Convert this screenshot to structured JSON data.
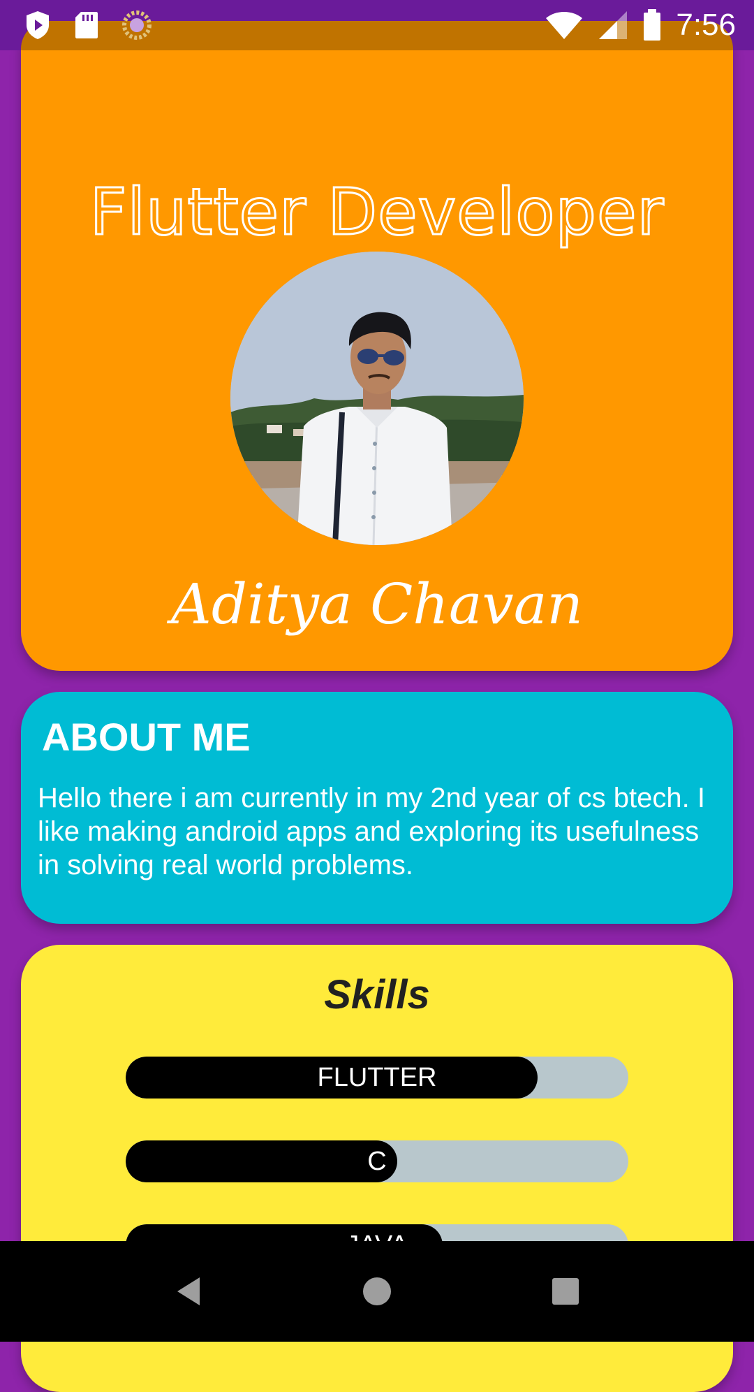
{
  "status_bar": {
    "time": "7:56",
    "left_icons": [
      "play-protect-icon",
      "sd-card-icon",
      "loading-icon"
    ],
    "right_icons": [
      "wifi-icon",
      "signal-icon",
      "battery-icon"
    ]
  },
  "profile": {
    "title": "Flutter Developer",
    "name": "Aditya Chavan",
    "avatar": "profile-photo"
  },
  "about": {
    "heading": "ABOUT ME",
    "text": "Hello there i am currently in my 2nd year of cs btech. I like making android apps and exploring its usefulness in solving real world problems."
  },
  "skills": {
    "heading": "Skills",
    "items": [
      {
        "label": "FLUTTER",
        "level": 0.82
      },
      {
        "label": "C",
        "level": 0.54
      },
      {
        "label": "JAVA",
        "level": 0.63
      }
    ]
  },
  "nav_bar": {
    "buttons": [
      "back-icon",
      "home-icon",
      "recents-icon"
    ]
  },
  "colors": {
    "background": "#8E24AA",
    "profile_card": "#FF9800",
    "about_card": "#00BCD4",
    "skills_card": "#FFEB3B",
    "skill_track": "#B8C7CC",
    "skill_fill": "#000000"
  }
}
